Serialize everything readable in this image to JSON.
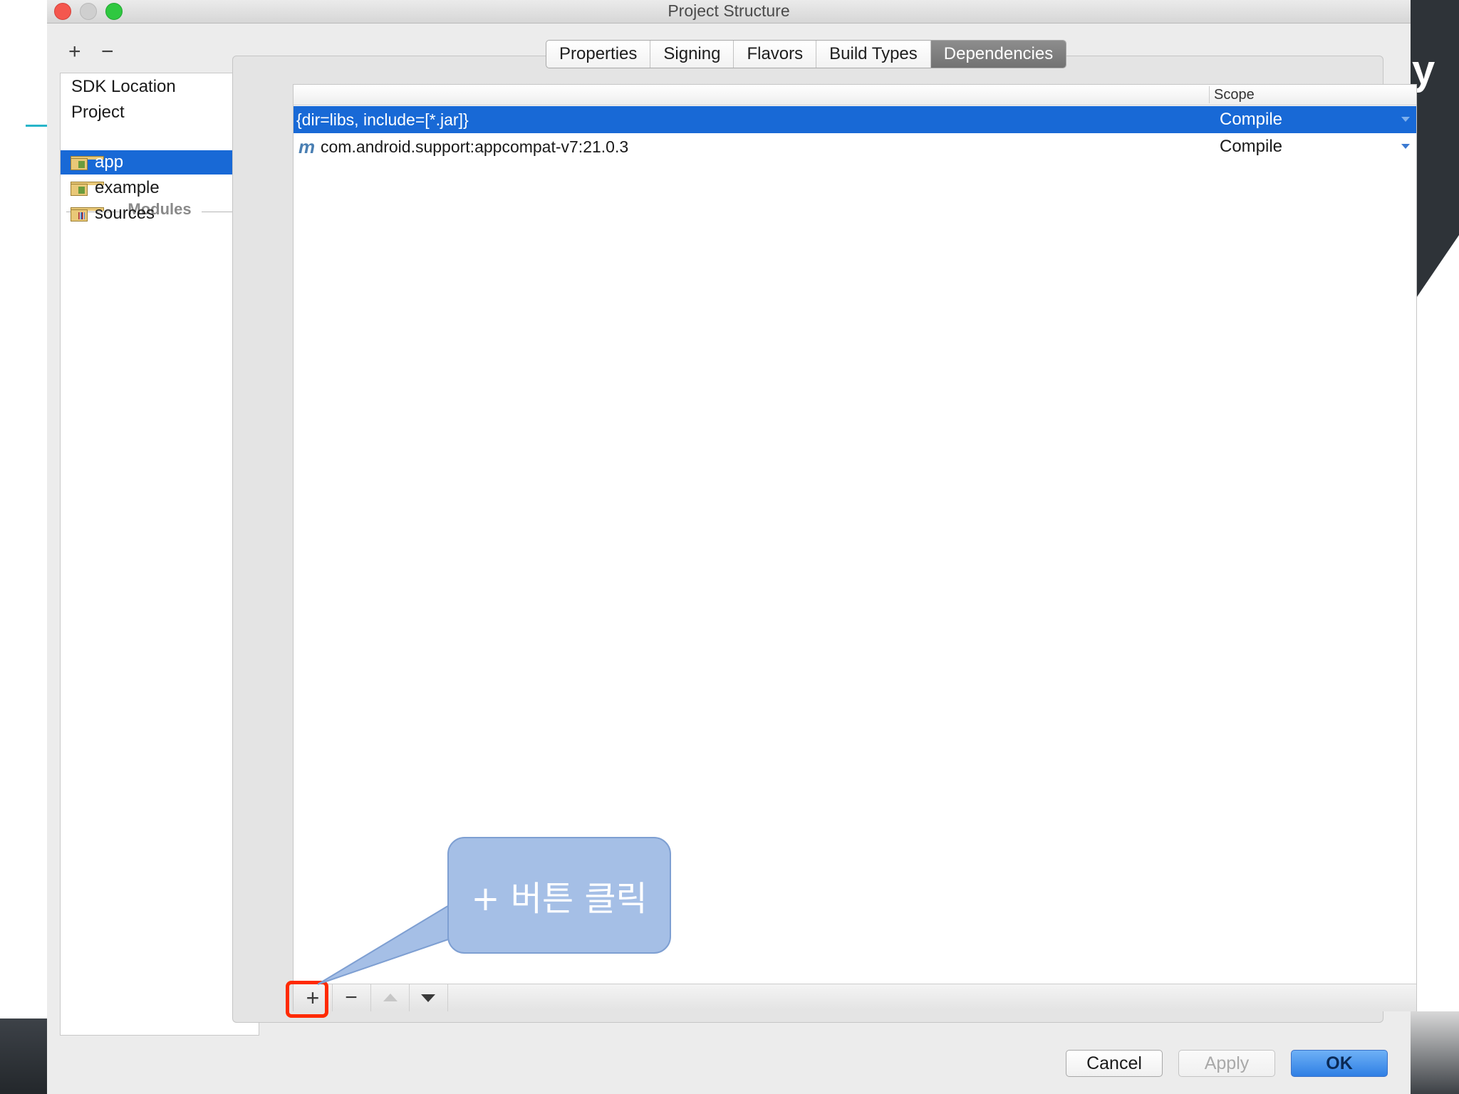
{
  "window": {
    "title": "Project Structure"
  },
  "sidebar": {
    "add_label": "+",
    "remove_label": "−",
    "items": [
      {
        "label": "SDK Location"
      },
      {
        "label": "Project"
      }
    ],
    "section_label": "Modules",
    "modules": [
      {
        "label": "app",
        "selected": true,
        "icon": "android-module-icon"
      },
      {
        "label": "example",
        "selected": false,
        "icon": "android-module-icon"
      },
      {
        "label": "sources",
        "selected": false,
        "icon": "library-module-icon"
      }
    ]
  },
  "tabs": [
    {
      "label": "Properties",
      "active": false
    },
    {
      "label": "Signing",
      "active": false
    },
    {
      "label": "Flavors",
      "active": false
    },
    {
      "label": "Build Types",
      "active": false
    },
    {
      "label": "Dependencies",
      "active": true
    }
  ],
  "table": {
    "columns": {
      "scope": "Scope"
    },
    "rows": [
      {
        "dependency": "{dir=libs, include=[*.jar]}",
        "scope": "Compile",
        "selected": true,
        "icon": ""
      },
      {
        "dependency": "com.android.support:appcompat-v7:21.0.3",
        "scope": "Compile",
        "selected": false,
        "icon": "maven-icon",
        "icon_glyph": "m"
      }
    ],
    "toolbar": {
      "add": "+",
      "remove": "−"
    }
  },
  "callout": {
    "text": "+ 버튼 클릭",
    "color": "#a5bfe6"
  },
  "buttons": {
    "cancel": "Cancel",
    "apply": "Apply",
    "ok": "OK"
  },
  "background": {
    "right_glyph": "y"
  },
  "colors": {
    "selection": "#1869d6",
    "highlight": "#ff2a00"
  }
}
